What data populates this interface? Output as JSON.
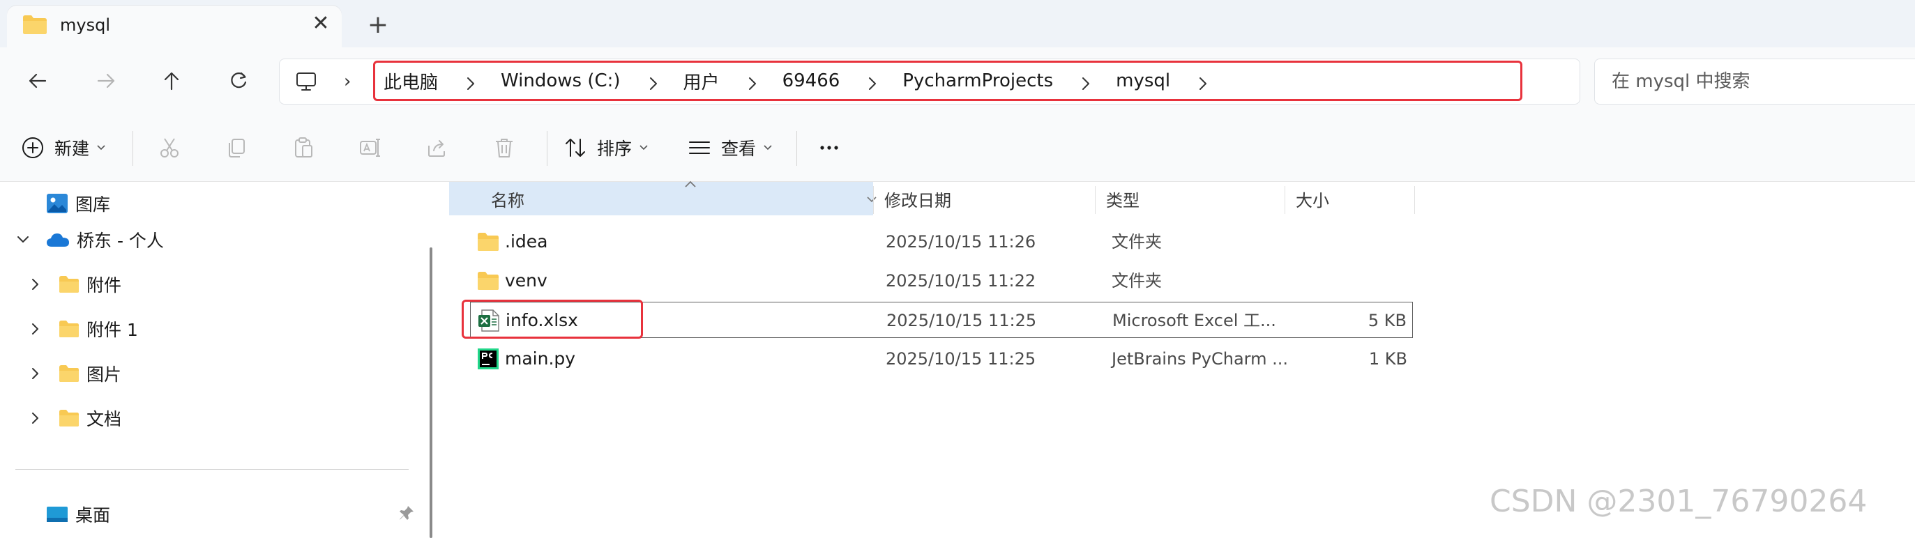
{
  "tab": {
    "title": "mysql"
  },
  "breadcrumbs": [
    "此电脑",
    "Windows (C:)",
    "用户",
    "69466",
    "PycharmProjects",
    "mysql"
  ],
  "search": {
    "placeholder": "在 mysql 中搜索"
  },
  "toolbar": {
    "new_label": "新建",
    "sort_label": "排序",
    "view_label": "查看"
  },
  "sidebar": {
    "items": [
      {
        "label": "图库"
      },
      {
        "label": "桥东 - 个人"
      },
      {
        "label": "附件"
      },
      {
        "label": "附件 1"
      },
      {
        "label": "图片"
      },
      {
        "label": "文档"
      },
      {
        "label": "桌面"
      }
    ]
  },
  "columns": [
    "名称",
    "修改日期",
    "类型",
    "大小"
  ],
  "files": [
    {
      "name": ".idea",
      "modified": "2025/10/15 11:26",
      "type": "文件夹",
      "size": "",
      "icon": "folder-icon"
    },
    {
      "name": "venv",
      "modified": "2025/10/15 11:22",
      "type": "文件夹",
      "size": "",
      "icon": "folder-icon"
    },
    {
      "name": "info.xlsx",
      "modified": "2025/10/15 11:25",
      "type": "Microsoft Excel 工...",
      "size": "5 KB",
      "icon": "excel-file-icon"
    },
    {
      "name": "main.py",
      "modified": "2025/10/15 11:25",
      "type": "JetBrains PyCharm ...",
      "size": "1 KB",
      "icon": "pycharm-file-icon"
    }
  ],
  "watermark": "CSDN @2301_76790264",
  "colors": {
    "accent": "#0067c0",
    "highlight": "#e8323c",
    "folder": "#f8c953",
    "excel": "#1d6f42"
  }
}
